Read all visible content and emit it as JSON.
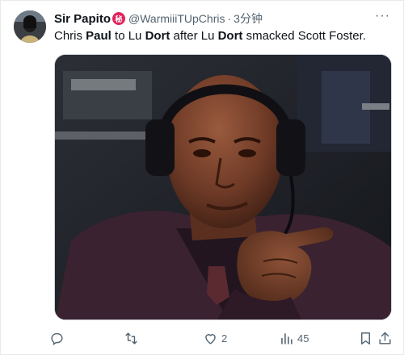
{
  "tweet": {
    "author_name": "Sir Papito",
    "badge_glyph": "秘",
    "handle": "@WarmiiiTUpChris",
    "separator": "·",
    "time": "3分钟",
    "more_glyph": "···",
    "text_parts": [
      {
        "text": "Chris ",
        "bold": false
      },
      {
        "text": "Paul",
        "bold": true
      },
      {
        "text": " to Lu ",
        "bold": false
      },
      {
        "text": "Dort",
        "bold": true
      },
      {
        "text": " after Lu ",
        "bold": false
      },
      {
        "text": "Dort",
        "bold": true
      },
      {
        "text": " smacked Scott Foster.",
        "bold": false
      }
    ]
  },
  "media": {
    "icon": "photo-man-with-headset-pointing"
  },
  "actions": {
    "reply": {
      "icon": "reply-icon",
      "count": ""
    },
    "retweet": {
      "icon": "retweet-icon",
      "count": ""
    },
    "like": {
      "icon": "heart-icon",
      "count": "2"
    },
    "views": {
      "icon": "views-icon",
      "count": "45"
    },
    "bookmark": {
      "icon": "bookmark-icon",
      "count": ""
    },
    "share": {
      "icon": "share-icon",
      "count": ""
    }
  },
  "colors": {
    "text": "#0f1419",
    "secondary": "#536471",
    "badge": "#e0245e",
    "border": "#cfd9de"
  }
}
